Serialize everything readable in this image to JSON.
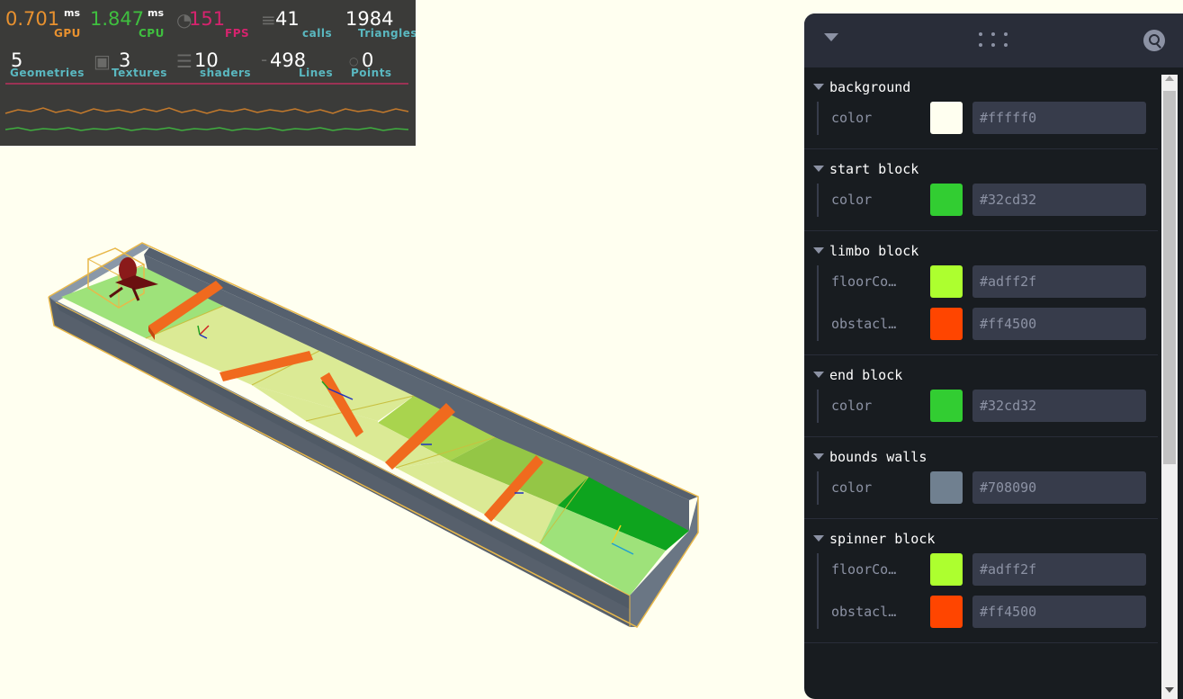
{
  "perf": {
    "stats": [
      {
        "value": "0.701",
        "unit": "ms",
        "label": "GPU",
        "value_color": "#e8912f",
        "label_color": "#e8912f"
      },
      {
        "value": "1.847",
        "unit": "ms",
        "label": "CPU",
        "value_color": "#3fbf3f",
        "label_color": "#3fbf3f"
      },
      {
        "value": "151",
        "label": "FPS",
        "value_color": "#d6236e",
        "label_color": "#d6236e"
      },
      {
        "value": "41",
        "label": "calls",
        "value_color": "#ffffff",
        "label_color": "#5ab8c0"
      },
      {
        "value": "1984",
        "label": "Triangles",
        "value_color": "#ffffff",
        "label_color": "#5ab8c0"
      },
      {
        "value": "5",
        "label": "Geometries",
        "value_color": "#ffffff",
        "label_color": "#5ab8c0"
      },
      {
        "value": "3",
        "label": "Textures",
        "value_color": "#ffffff",
        "label_color": "#5ab8c0"
      },
      {
        "value": "10",
        "label": "shaders",
        "value_color": "#ffffff",
        "label_color": "#5ab8c0"
      },
      {
        "value": "498",
        "label": "Lines",
        "value_color": "#ffffff",
        "label_color": "#5ab8c0"
      },
      {
        "value": "0",
        "label": "Points",
        "value_color": "#ffffff",
        "label_color": "#5ab8c0"
      }
    ]
  },
  "panel": {
    "folders": [
      {
        "title": "background",
        "rows": [
          {
            "name": "color",
            "hex": "#fffff0"
          }
        ]
      },
      {
        "title": "start block",
        "rows": [
          {
            "name": "color",
            "hex": "#32cd32"
          }
        ]
      },
      {
        "title": "limbo block",
        "rows": [
          {
            "name": "floorCo…",
            "hex": "#adff2f"
          },
          {
            "name": "obstacl…",
            "hex": "#ff4500"
          }
        ]
      },
      {
        "title": "end block",
        "rows": [
          {
            "name": "color",
            "hex": "#32cd32"
          }
        ]
      },
      {
        "title": "bounds walls",
        "rows": [
          {
            "name": "color",
            "hex": "#708090"
          }
        ]
      },
      {
        "title": "spinner block",
        "rows": [
          {
            "name": "floorCo…",
            "hex": "#adff2f"
          },
          {
            "name": "obstacl…",
            "hex": "#ff4500"
          }
        ]
      }
    ]
  },
  "scene": {
    "wall_color": "#708090",
    "start_color": "#32cd32",
    "floor_color": "#adff2f",
    "obstacle_color": "#ff4500",
    "outline_color": "#e8b84a"
  }
}
